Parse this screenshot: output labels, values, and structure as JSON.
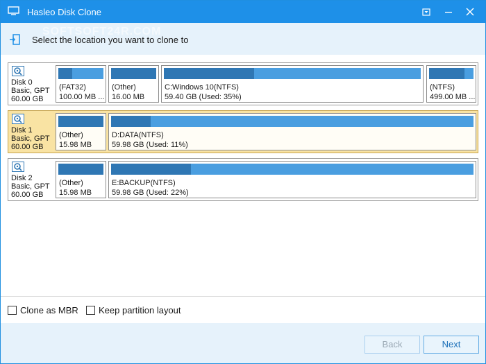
{
  "window": {
    "title": "Hasleo Disk Clone",
    "accent": "#1e90e8"
  },
  "header": {
    "instruction": "Select the location you want to clone to",
    "watermark": "SOFTSOFT24R.COM"
  },
  "disks": [
    {
      "name": "Disk 0",
      "type": "Basic, GPT",
      "size": "60.00 GB",
      "selected": false,
      "partitions": [
        {
          "label": "(FAT32)",
          "detail": "100.00 MB ...",
          "used_fraction": 0.3
        },
        {
          "label": "(Other)",
          "detail": "16.00 MB",
          "used_fraction": 1.0
        },
        {
          "label": "C:Windows 10(NTFS)",
          "detail": "59.40 GB (Used: 35%)",
          "used_fraction": 0.35
        },
        {
          "label": "(NTFS)",
          "detail": "499.00 MB ...",
          "used_fraction": 0.8
        }
      ]
    },
    {
      "name": "Disk 1",
      "type": "Basic, GPT",
      "size": "60.00 GB",
      "selected": true,
      "partitions": [
        {
          "label": "(Other)",
          "detail": "15.98 MB",
          "used_fraction": 1.0
        },
        {
          "label": "D:DATA(NTFS)",
          "detail": "59.98 GB (Used: 11%)",
          "used_fraction": 0.11
        }
      ]
    },
    {
      "name": "Disk 2",
      "type": "Basic, GPT",
      "size": "60.00 GB",
      "selected": false,
      "partitions": [
        {
          "label": "(Other)",
          "detail": "15.98 MB",
          "used_fraction": 1.0
        },
        {
          "label": "E:BACKUP(NTFS)",
          "detail": "59.98 GB (Used: 22%)",
          "used_fraction": 0.22
        }
      ]
    }
  ],
  "options": {
    "clone_as_mbr": "Clone as MBR",
    "keep_layout": "Keep partition layout"
  },
  "buttons": {
    "back": "Back",
    "next": "Next"
  }
}
